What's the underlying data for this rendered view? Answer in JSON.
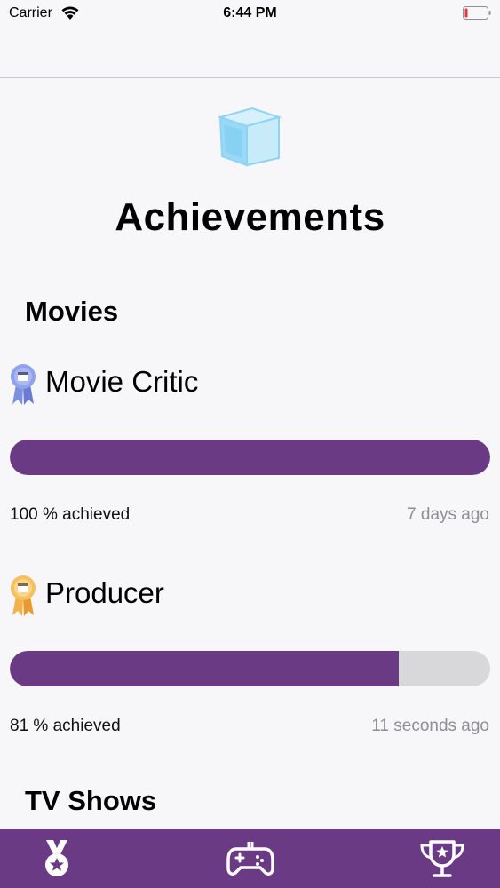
{
  "status_bar": {
    "carrier": "Carrier",
    "time": "6:44 PM",
    "battery_color": "#e0393e"
  },
  "page": {
    "title": "Achievements",
    "hero_icon": "ice-cube-icon"
  },
  "sections": [
    {
      "title": "Movies",
      "achievements": [
        {
          "name": "Movie Critic",
          "icon": "purple-ribbon-icon",
          "progress": 1.0,
          "percent_label": "100 % achieved",
          "time_label": "7 days ago"
        },
        {
          "name": "Producer",
          "icon": "gold-ribbon-icon",
          "progress": 0.81,
          "percent_label": "81 % achieved",
          "time_label": "11 seconds ago"
        }
      ]
    },
    {
      "title": "TV Shows",
      "achievements": []
    }
  ],
  "tab_bar": {
    "tabs": [
      {
        "icon": "medal-icon"
      },
      {
        "icon": "gamepad-icon"
      },
      {
        "icon": "trophy-icon"
      }
    ],
    "background": "#6b3a85"
  },
  "colors": {
    "accent": "#6b3a85",
    "track": "#d8d7da",
    "secondary_text": "#8e8e93"
  }
}
